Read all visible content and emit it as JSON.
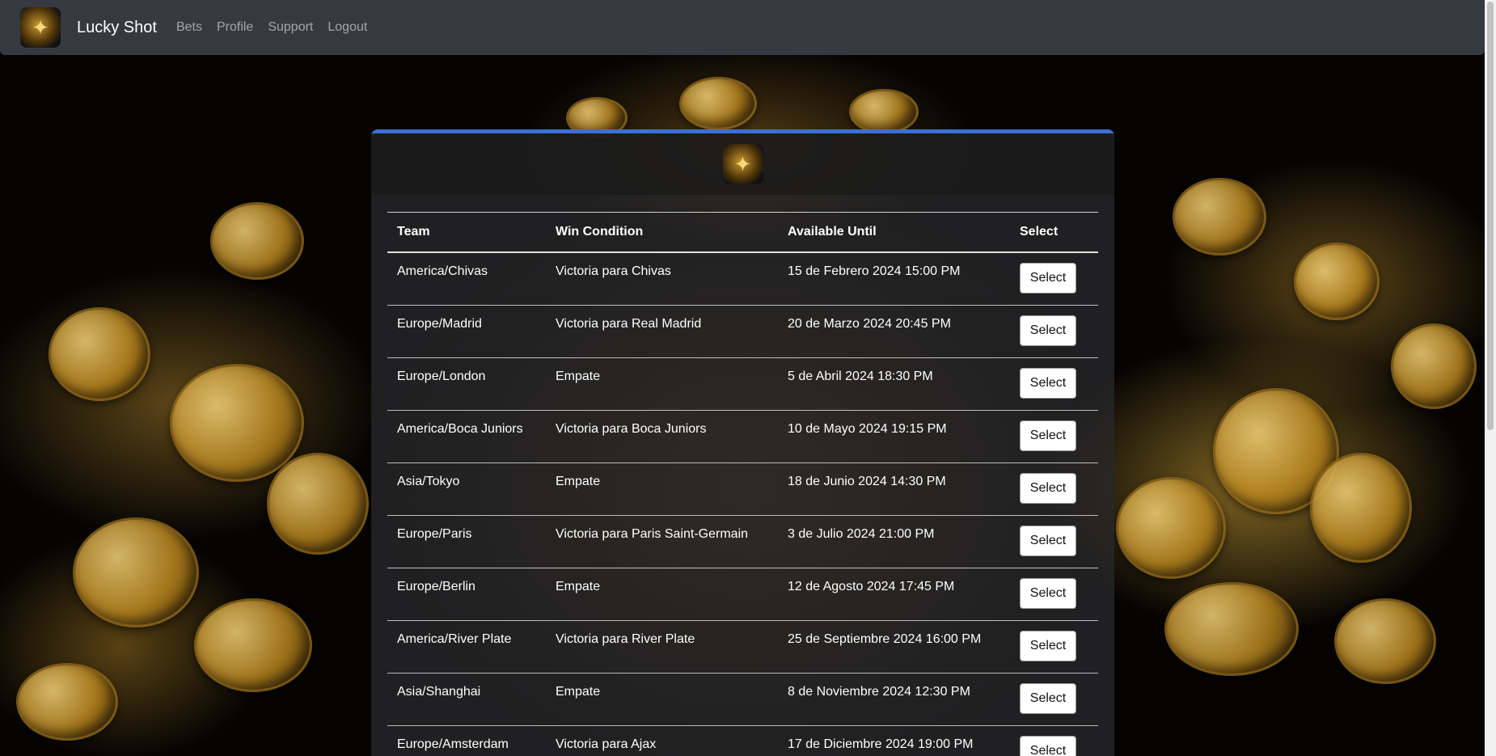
{
  "navbar": {
    "logo_icon": "coin-logo-icon",
    "brand": "Lucky Shot",
    "links": [
      "Bets",
      "Profile",
      "Support",
      "Logout"
    ]
  },
  "card": {
    "logo_icon": "coin-logo-icon",
    "accent_color": "#3c6fd3"
  },
  "table": {
    "headers": [
      "Team",
      "Win Condition",
      "Available Until",
      "Select"
    ],
    "rows": [
      {
        "team": "America/Chivas",
        "condition": "Victoria para Chivas",
        "until": "15 de Febrero 2024 15:00 PM",
        "action": "Select"
      },
      {
        "team": "Europe/Madrid",
        "condition": "Victoria para Real Madrid",
        "until": "20 de Marzo 2024 20:45 PM",
        "action": "Select"
      },
      {
        "team": "Europe/London",
        "condition": "Empate",
        "until": "5 de Abril 2024 18:30 PM",
        "action": "Select"
      },
      {
        "team": "America/Boca Juniors",
        "condition": "Victoria para Boca Juniors",
        "until": "10 de Mayo 2024 19:15 PM",
        "action": "Select"
      },
      {
        "team": "Asia/Tokyo",
        "condition": "Empate",
        "until": "18 de Junio 2024 14:30 PM",
        "action": "Select"
      },
      {
        "team": "Europe/Paris",
        "condition": "Victoria para Paris Saint-Germain",
        "until": "3 de Julio 2024 21:00 PM",
        "action": "Select"
      },
      {
        "team": "Europe/Berlin",
        "condition": "Empate",
        "until": "12 de Agosto 2024 17:45 PM",
        "action": "Select"
      },
      {
        "team": "America/River Plate",
        "condition": "Victoria para River Plate",
        "until": "25 de Septiembre 2024 16:00 PM",
        "action": "Select"
      },
      {
        "team": "Asia/Shanghai",
        "condition": "Empate",
        "until": "8 de Noviembre 2024 12:30 PM",
        "action": "Select"
      },
      {
        "team": "Europe/Amsterdam",
        "condition": "Victoria para Ajax",
        "until": "17 de Diciembre 2024 19:00 PM",
        "action": "Select"
      }
    ]
  }
}
